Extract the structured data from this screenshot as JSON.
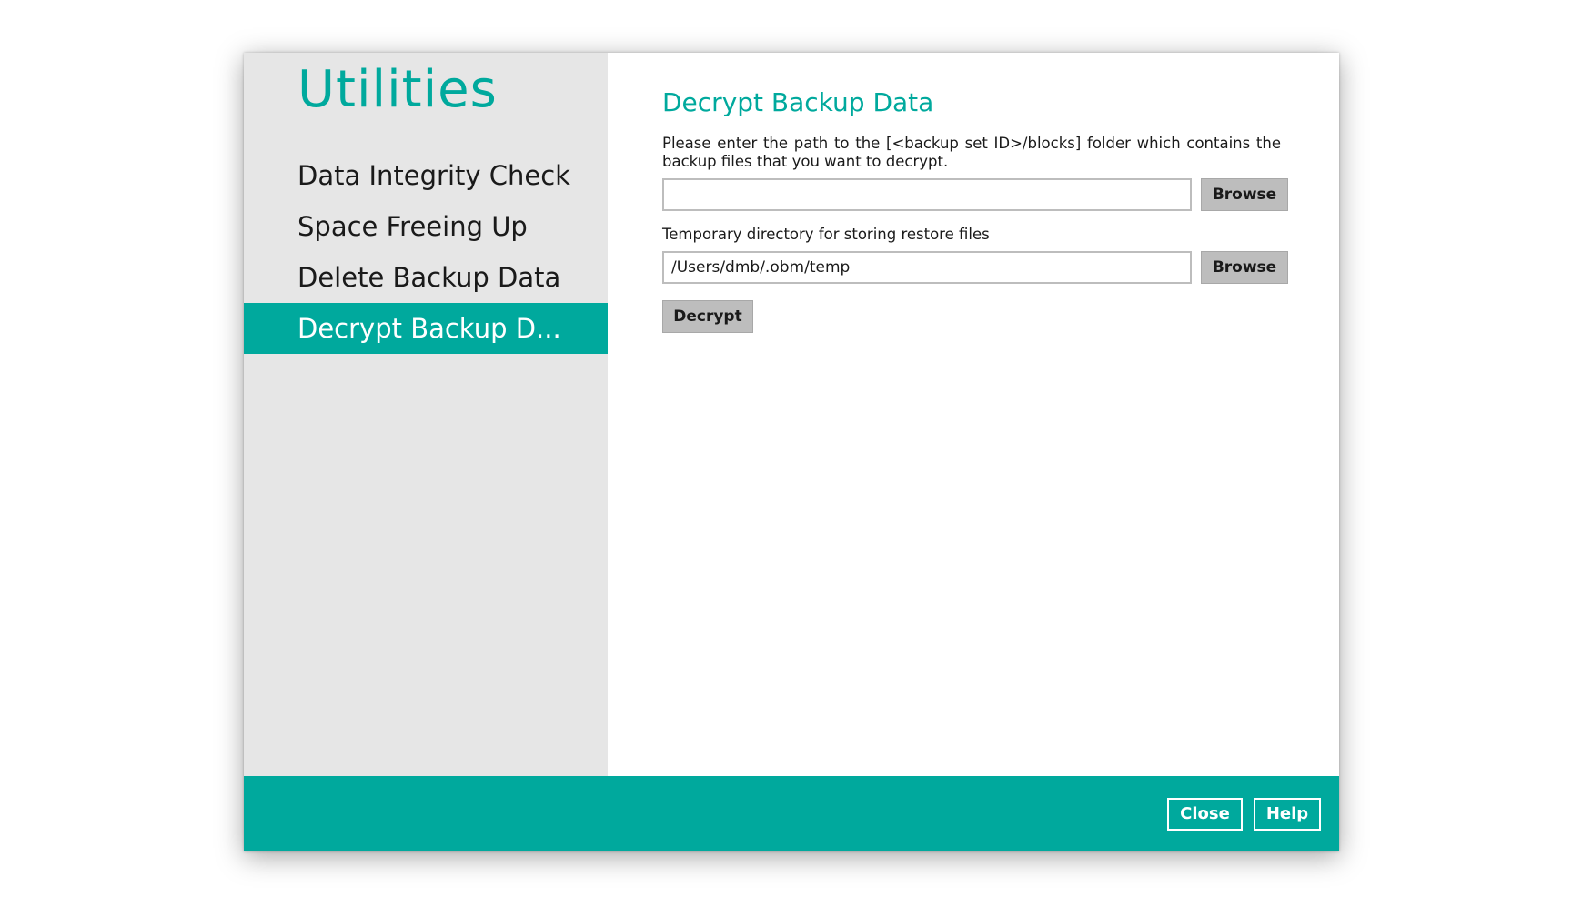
{
  "sidebar": {
    "title": "Utilities",
    "items": [
      {
        "label": "Data Integrity Check",
        "active": false
      },
      {
        "label": "Space Freeing Up",
        "active": false
      },
      {
        "label": "Delete Backup Data",
        "active": false
      },
      {
        "label": "Decrypt Backup D...",
        "active": true
      }
    ]
  },
  "main": {
    "title": "Decrypt Backup Data",
    "description": "Please enter the path to the [<backup set ID>/blocks] folder which contains the backup files that you want to decrypt.",
    "backup_path": {
      "value": "",
      "browse_label": "Browse"
    },
    "temp_dir": {
      "label": "Temporary directory for storing restore files",
      "value": "/Users/dmb/.obm/temp",
      "browse_label": "Browse"
    },
    "decrypt_label": "Decrypt"
  },
  "footer": {
    "close_label": "Close",
    "help_label": "Help"
  },
  "colors": {
    "accent": "#00a99d",
    "sidebar_bg": "#e6e6e6",
    "button_gray": "#bdbdbd"
  }
}
